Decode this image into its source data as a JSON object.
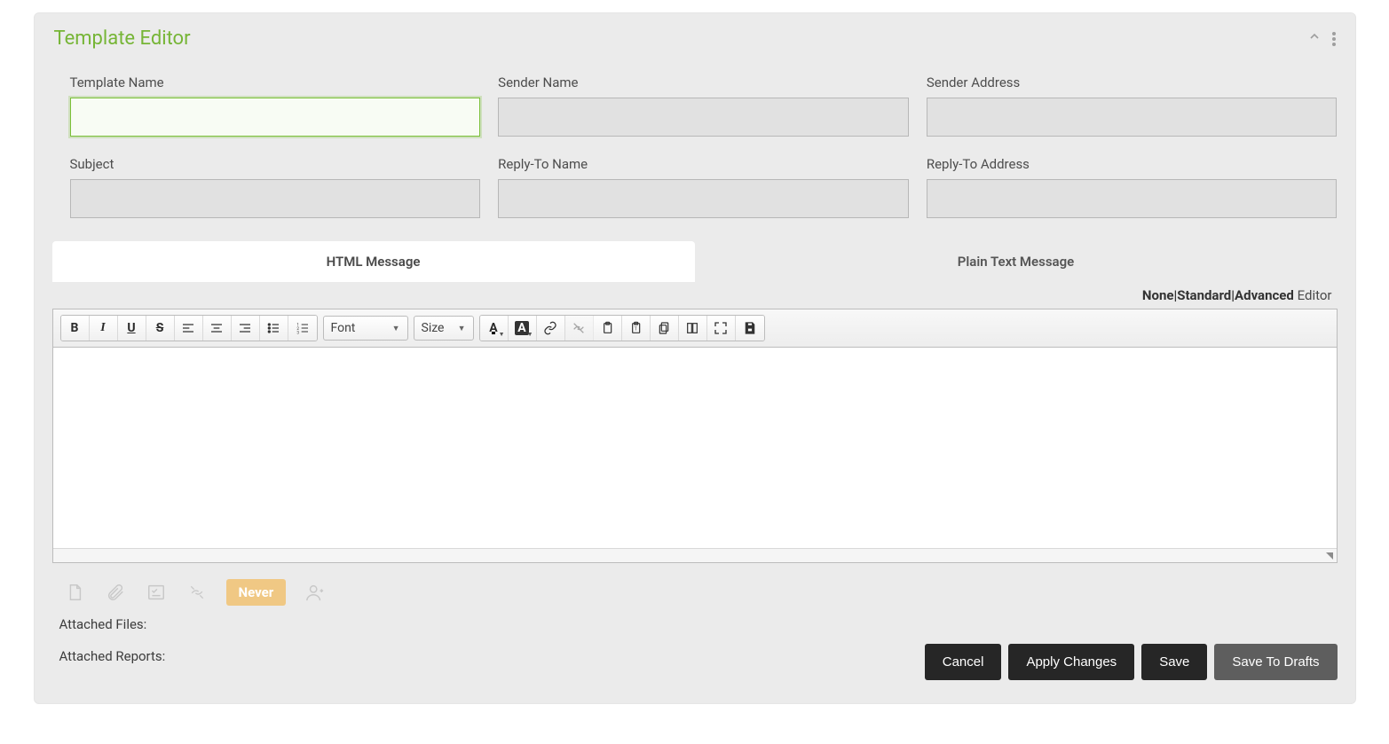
{
  "header": {
    "title": "Template Editor"
  },
  "fields": {
    "template_name": {
      "label": "Template Name",
      "value": ""
    },
    "sender_name": {
      "label": "Sender Name",
      "value": ""
    },
    "sender_address": {
      "label": "Sender Address",
      "value": ""
    },
    "subject": {
      "label": "Subject",
      "value": ""
    },
    "reply_to_name": {
      "label": "Reply-To Name",
      "value": ""
    },
    "reply_to_address": {
      "label": "Reply-To Address",
      "value": ""
    }
  },
  "tabs": {
    "html": "HTML Message",
    "plain": "Plain Text Message"
  },
  "editor_modes": {
    "none": "None",
    "standard": "Standard",
    "advanced": "Advanced",
    "suffix": "Editor"
  },
  "toolbar": {
    "font_label": "Font",
    "size_label": "Size",
    "text_a": "A"
  },
  "bottom": {
    "never": "Never",
    "attached_files": "Attached Files:",
    "attached_reports": "Attached Reports:"
  },
  "buttons": {
    "cancel": "Cancel",
    "apply": "Apply Changes",
    "save": "Save",
    "drafts": "Save To Drafts"
  }
}
